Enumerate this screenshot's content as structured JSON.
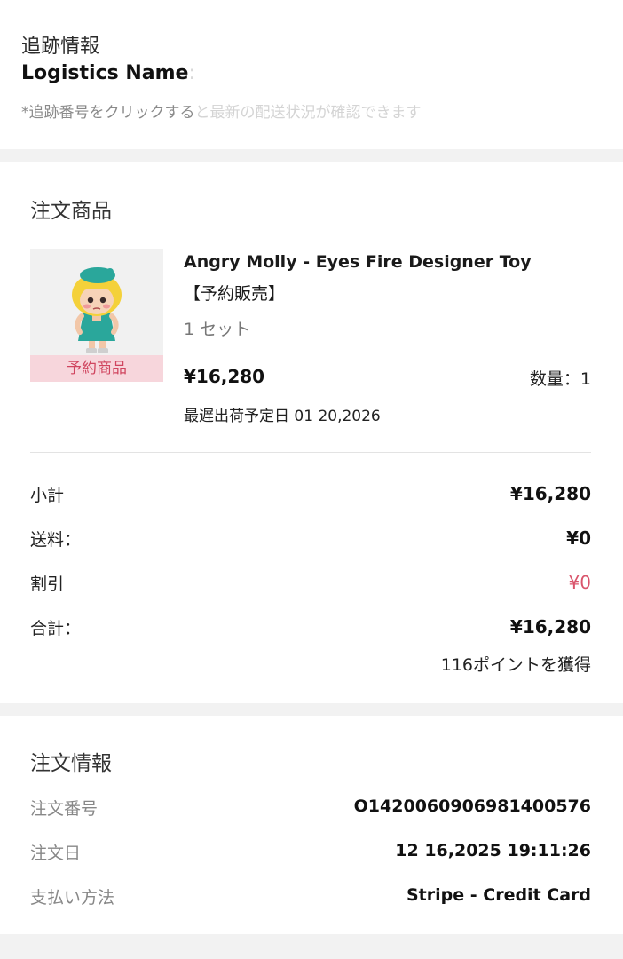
{
  "tracking": {
    "title": "追跡情報",
    "logistics_label": "Logistics Name",
    "logistics_faded": ": ",
    "note_visible": "*追跡番号をクリックする",
    "note_faded": "と最新の配送状況が確認できます"
  },
  "items": {
    "section_title": "注文商品",
    "product": {
      "name": "Angry Molly - Eyes Fire Designer Toy",
      "subtitle": "【予約販売】",
      "set_count": "1 セット",
      "price": "¥16,280",
      "quantity": "数量：1",
      "shipping_date": "最遅出荷予定日 01 20,2026",
      "badge": "予約商品",
      "thumbnail_icon": "figure-toy-icon"
    },
    "summary": {
      "subtotal_label": "小計",
      "subtotal_value": "¥16,280",
      "shipping_label": "送料：",
      "shipping_value": "¥0",
      "discount_label": "割引",
      "discount_value": "¥0",
      "total_label": "合計：",
      "total_value": "¥16,280",
      "points": "116ポイントを獲得"
    }
  },
  "order_info": {
    "section_title": "注文情報",
    "order_number_label": "注文番号",
    "order_number_value": "O142006090698140057​6",
    "order_date_label": "注文日",
    "order_date_value": "12 16,2025 19:11:26",
    "payment_label": "支払い方法",
    "payment_value": "Stripe - Credit Card"
  },
  "colors": {
    "discount_red": "#d9546b",
    "badge_bg": "#f7d6dc",
    "badge_text": "#d0455f",
    "page_bg": "#f2f2f2"
  }
}
